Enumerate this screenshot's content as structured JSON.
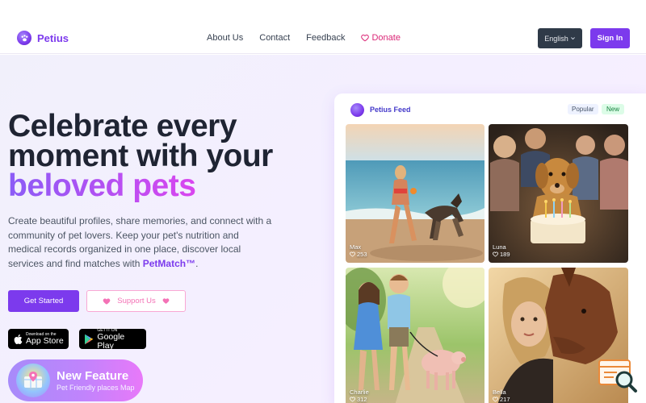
{
  "brand": {
    "name": "Petius"
  },
  "nav": {
    "links": [
      "About Us",
      "Contact",
      "Feedback"
    ],
    "donate": "Donate",
    "language": "English",
    "signin": "Sign In"
  },
  "hero": {
    "title_line1": "Celebrate every",
    "title_line2": "moment with your",
    "title_accent": "beloved pets",
    "desc": "Create beautiful profiles, share memories, and connect with a community of pet lovers. Keep your pet's nutrition and medical records organized in one place, discover local services and find matches with ",
    "petmatch": "PetMatch™",
    "desc_end": ".",
    "cta_primary": "Get Started",
    "cta_secondary": "Support Us"
  },
  "stores": {
    "apple_small": "Download on the",
    "apple_big": "App Store",
    "google_small": "GET IT ON",
    "google_big": "Google Play"
  },
  "feature": {
    "title": "New Feature",
    "subtitle": "Pet Friendly places Map"
  },
  "feed": {
    "title": "Petius Feed",
    "tag_popular": "Popular",
    "tag_new": "New",
    "posts": [
      {
        "name": "Max",
        "likes": "253"
      },
      {
        "name": "Luna",
        "likes": "189"
      },
      {
        "name": "Charlie",
        "likes": "312"
      },
      {
        "name": "Bella",
        "likes": "217"
      }
    ]
  },
  "colors": {
    "brand": "#7c3aed",
    "donate": "#db2777",
    "dark_button": "#2f3a48"
  },
  "icons": [
    "paw-logo-icon",
    "heart-icon",
    "chevron-down-icon",
    "apple-icon",
    "google-play-icon",
    "map-feature-icon",
    "feedback-search-icon"
  ]
}
